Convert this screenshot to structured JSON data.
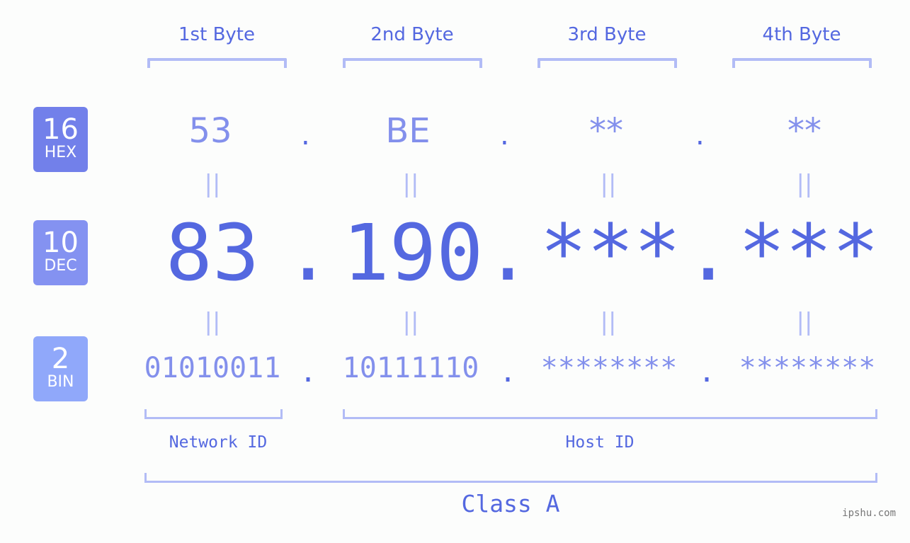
{
  "bytes": [
    {
      "header": "1st Byte",
      "hex": "53",
      "dec": "83",
      "bin": "01010011"
    },
    {
      "header": "2nd Byte",
      "hex": "BE",
      "dec": "190",
      "bin": "10111110"
    },
    {
      "header": "3rd Byte",
      "hex": "**",
      "dec": "***",
      "bin": "********"
    },
    {
      "header": "4th Byte",
      "hex": "**",
      "dec": "***",
      "bin": "********"
    }
  ],
  "separator": ".",
  "equals": "||",
  "badges": {
    "hex": {
      "num": "16",
      "label": "HEX",
      "color": "#7280ea"
    },
    "dec": {
      "num": "10",
      "label": "DEC",
      "color": "#8492f1"
    },
    "bin": {
      "num": "2",
      "label": "BIN",
      "color": "#90a8fa"
    }
  },
  "network_id_label": "Network ID",
  "host_id_label": "Host ID",
  "class_label": "Class A",
  "watermark": "ipshu.com",
  "colors": {
    "primary": "#5468e0",
    "light": "#8390ec",
    "bracket": "#b2bcf6"
  }
}
